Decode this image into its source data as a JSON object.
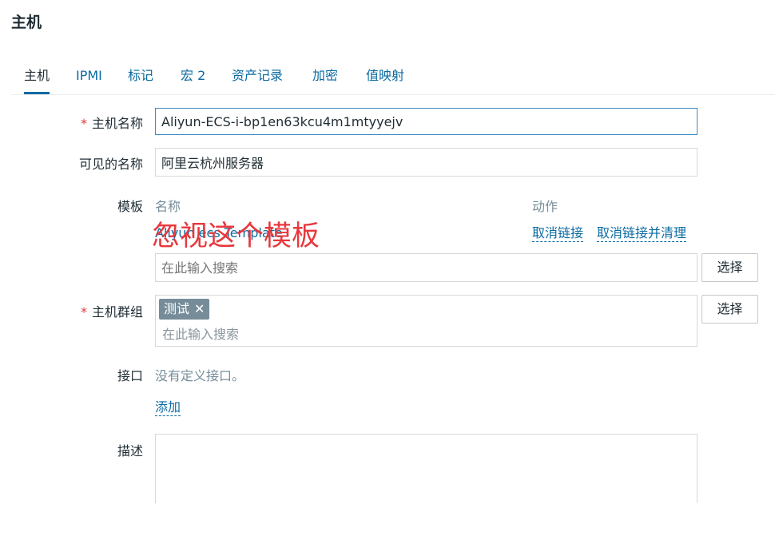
{
  "page": {
    "title": "主机"
  },
  "tabs": [
    {
      "label": "主机",
      "active": true
    },
    {
      "label": "IPMI"
    },
    {
      "label": "标记"
    },
    {
      "label": "宏 2"
    },
    {
      "label": "资产记录"
    },
    {
      "label": "加密"
    },
    {
      "label": "值映射"
    }
  ],
  "form": {
    "required_marker": "*",
    "host_name": {
      "label": "主机名称",
      "value": "Aliyun-ECS-i-bp1en63kcu4m1mtyyejv"
    },
    "visible_name": {
      "label": "可见的名称",
      "value": "阿里云杭州服务器"
    },
    "templates": {
      "label": "模板",
      "col_name": "名称",
      "col_action": "动作",
      "rows": [
        {
          "name": "Aliyun ecs Template",
          "unlink": "取消链接",
          "unlink_clear": "取消链接并清理"
        }
      ],
      "search_placeholder": "在此输入搜索",
      "select_button": "选择"
    },
    "host_groups": {
      "label": "主机群组",
      "tags": [
        {
          "label": "测试",
          "remove": "✕"
        }
      ],
      "search_placeholder": "在此输入搜索",
      "select_button": "选择"
    },
    "interfaces": {
      "label": "接口",
      "empty_text": "没有定义接口。",
      "add_link": "添加"
    },
    "description": {
      "label": "描述",
      "value": ""
    }
  },
  "annotation": {
    "text": "忽视这个模板",
    "color": "#e8383d"
  },
  "colors": {
    "accent": "#0a6aa1",
    "required": "#e33734",
    "muted": "#768d99",
    "tag_bg": "#768d99"
  }
}
